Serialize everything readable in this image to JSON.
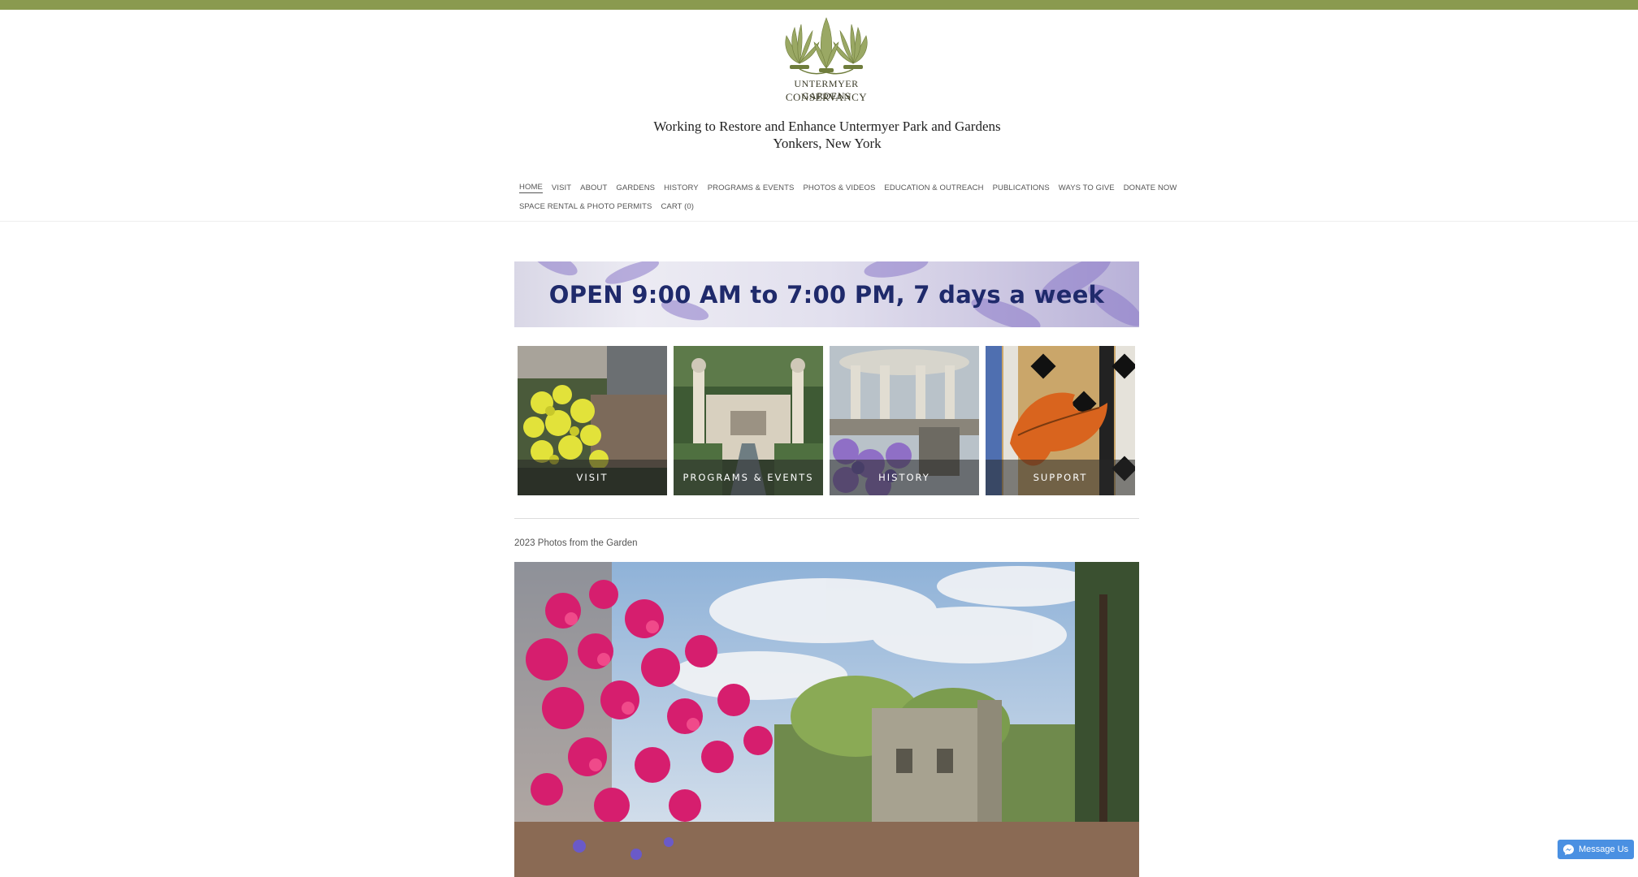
{
  "colors": {
    "top_bar": "#8a9a4f",
    "banner_text": "#1f2a6b",
    "messenger": "#4a90e2"
  },
  "header": {
    "logo": {
      "line1": "UNTERMYER GARDENS",
      "line2": "CONSERVANCY",
      "icon": "palmette-logo-icon"
    },
    "tagline_line1": "Working to Restore and Enhance Untermyer Park and Gardens",
    "tagline_line2": "Yonkers, New York"
  },
  "nav": {
    "row1": [
      "HOME",
      "VISIT",
      "ABOUT",
      "GARDENS",
      "HISTORY",
      "PROGRAMS & EVENTS",
      "PHOTOS & VIDEOS",
      "EDUCATION & OUTREACH",
      "PUBLICATIONS",
      "WAYS TO GIVE",
      "DONATE NOW"
    ],
    "row2": [
      "SPACE RENTAL & PHOTO PERMITS",
      "CART (0)"
    ],
    "active": "HOME"
  },
  "banner": {
    "text": "OPEN 9:00 AM to 7:00 PM, 7 days a week"
  },
  "tiles": [
    {
      "label": "VISIT"
    },
    {
      "label": "PROGRAMS & EVENTS"
    },
    {
      "label": "HISTORY"
    },
    {
      "label": "SUPPORT"
    }
  ],
  "gallery": {
    "title": "2023 Photos from the Garden"
  },
  "messenger": {
    "label": "Message Us",
    "icon": "messenger-icon"
  }
}
